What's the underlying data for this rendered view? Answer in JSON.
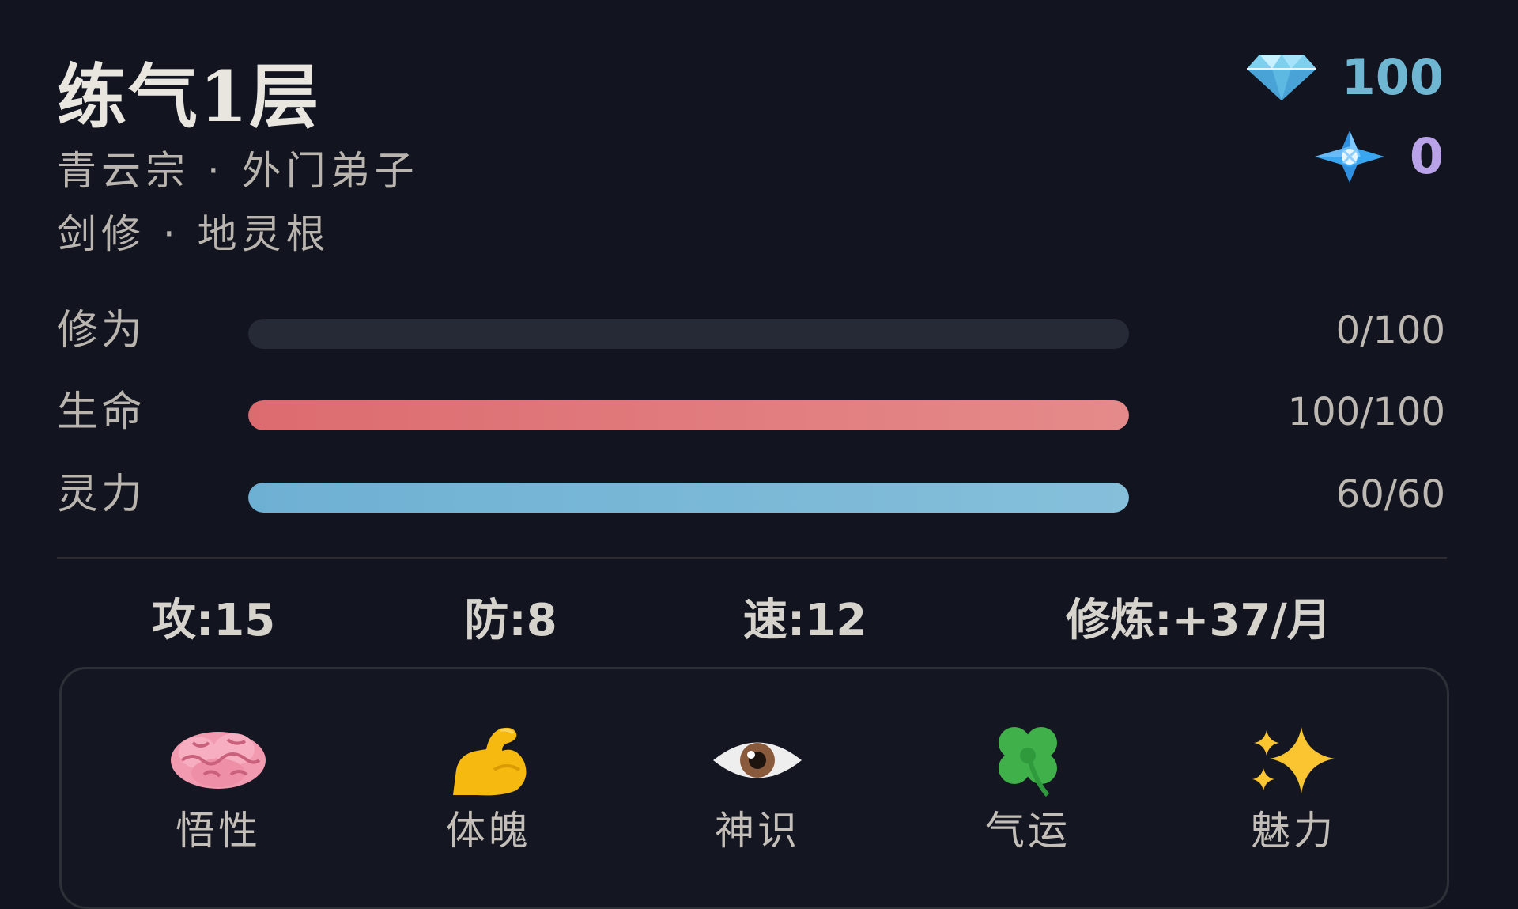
{
  "header": {
    "realm": "练气1层",
    "sect_line": "青云宗 · 外门弟子",
    "path_line": "剑修 · 地灵根"
  },
  "currency": {
    "spirit_stones": {
      "icon": "diamond-icon",
      "value": "100",
      "color": "#6fb6d3"
    },
    "crystals": {
      "icon": "blue-crystal-icon",
      "value": "0",
      "color": "#b9a2e8"
    }
  },
  "stats": [
    {
      "label": "修为",
      "value": "0/100",
      "fraction": 0,
      "color_start": "#3a3e4d",
      "color_end": "#3a3e4d"
    },
    {
      "label": "生命",
      "value": "100/100",
      "fraction": 1,
      "color_start": "#dc6b6f",
      "color_end": "#e58a8a"
    },
    {
      "label": "灵力",
      "value": "60/60",
      "fraction": 1,
      "color_start": "#6eb0d3",
      "color_end": "#85bfda"
    }
  ],
  "combat": {
    "attack": "攻:15",
    "defense": "防:8",
    "speed": "速:12",
    "cultivation": "修炼:+37/月"
  },
  "attributes": [
    {
      "label": "悟性",
      "icon": "brain-icon"
    },
    {
      "label": "体魄",
      "icon": "flexed-biceps-icon"
    },
    {
      "label": "神识",
      "icon": "eye-icon"
    },
    {
      "label": "气运",
      "icon": "four-leaf-clover-icon"
    },
    {
      "label": "魅力",
      "icon": "sparkles-icon"
    }
  ],
  "colors": {
    "background": "#121520",
    "text_primary": "#e9e6df",
    "text_secondary": "#b9b5ae"
  }
}
